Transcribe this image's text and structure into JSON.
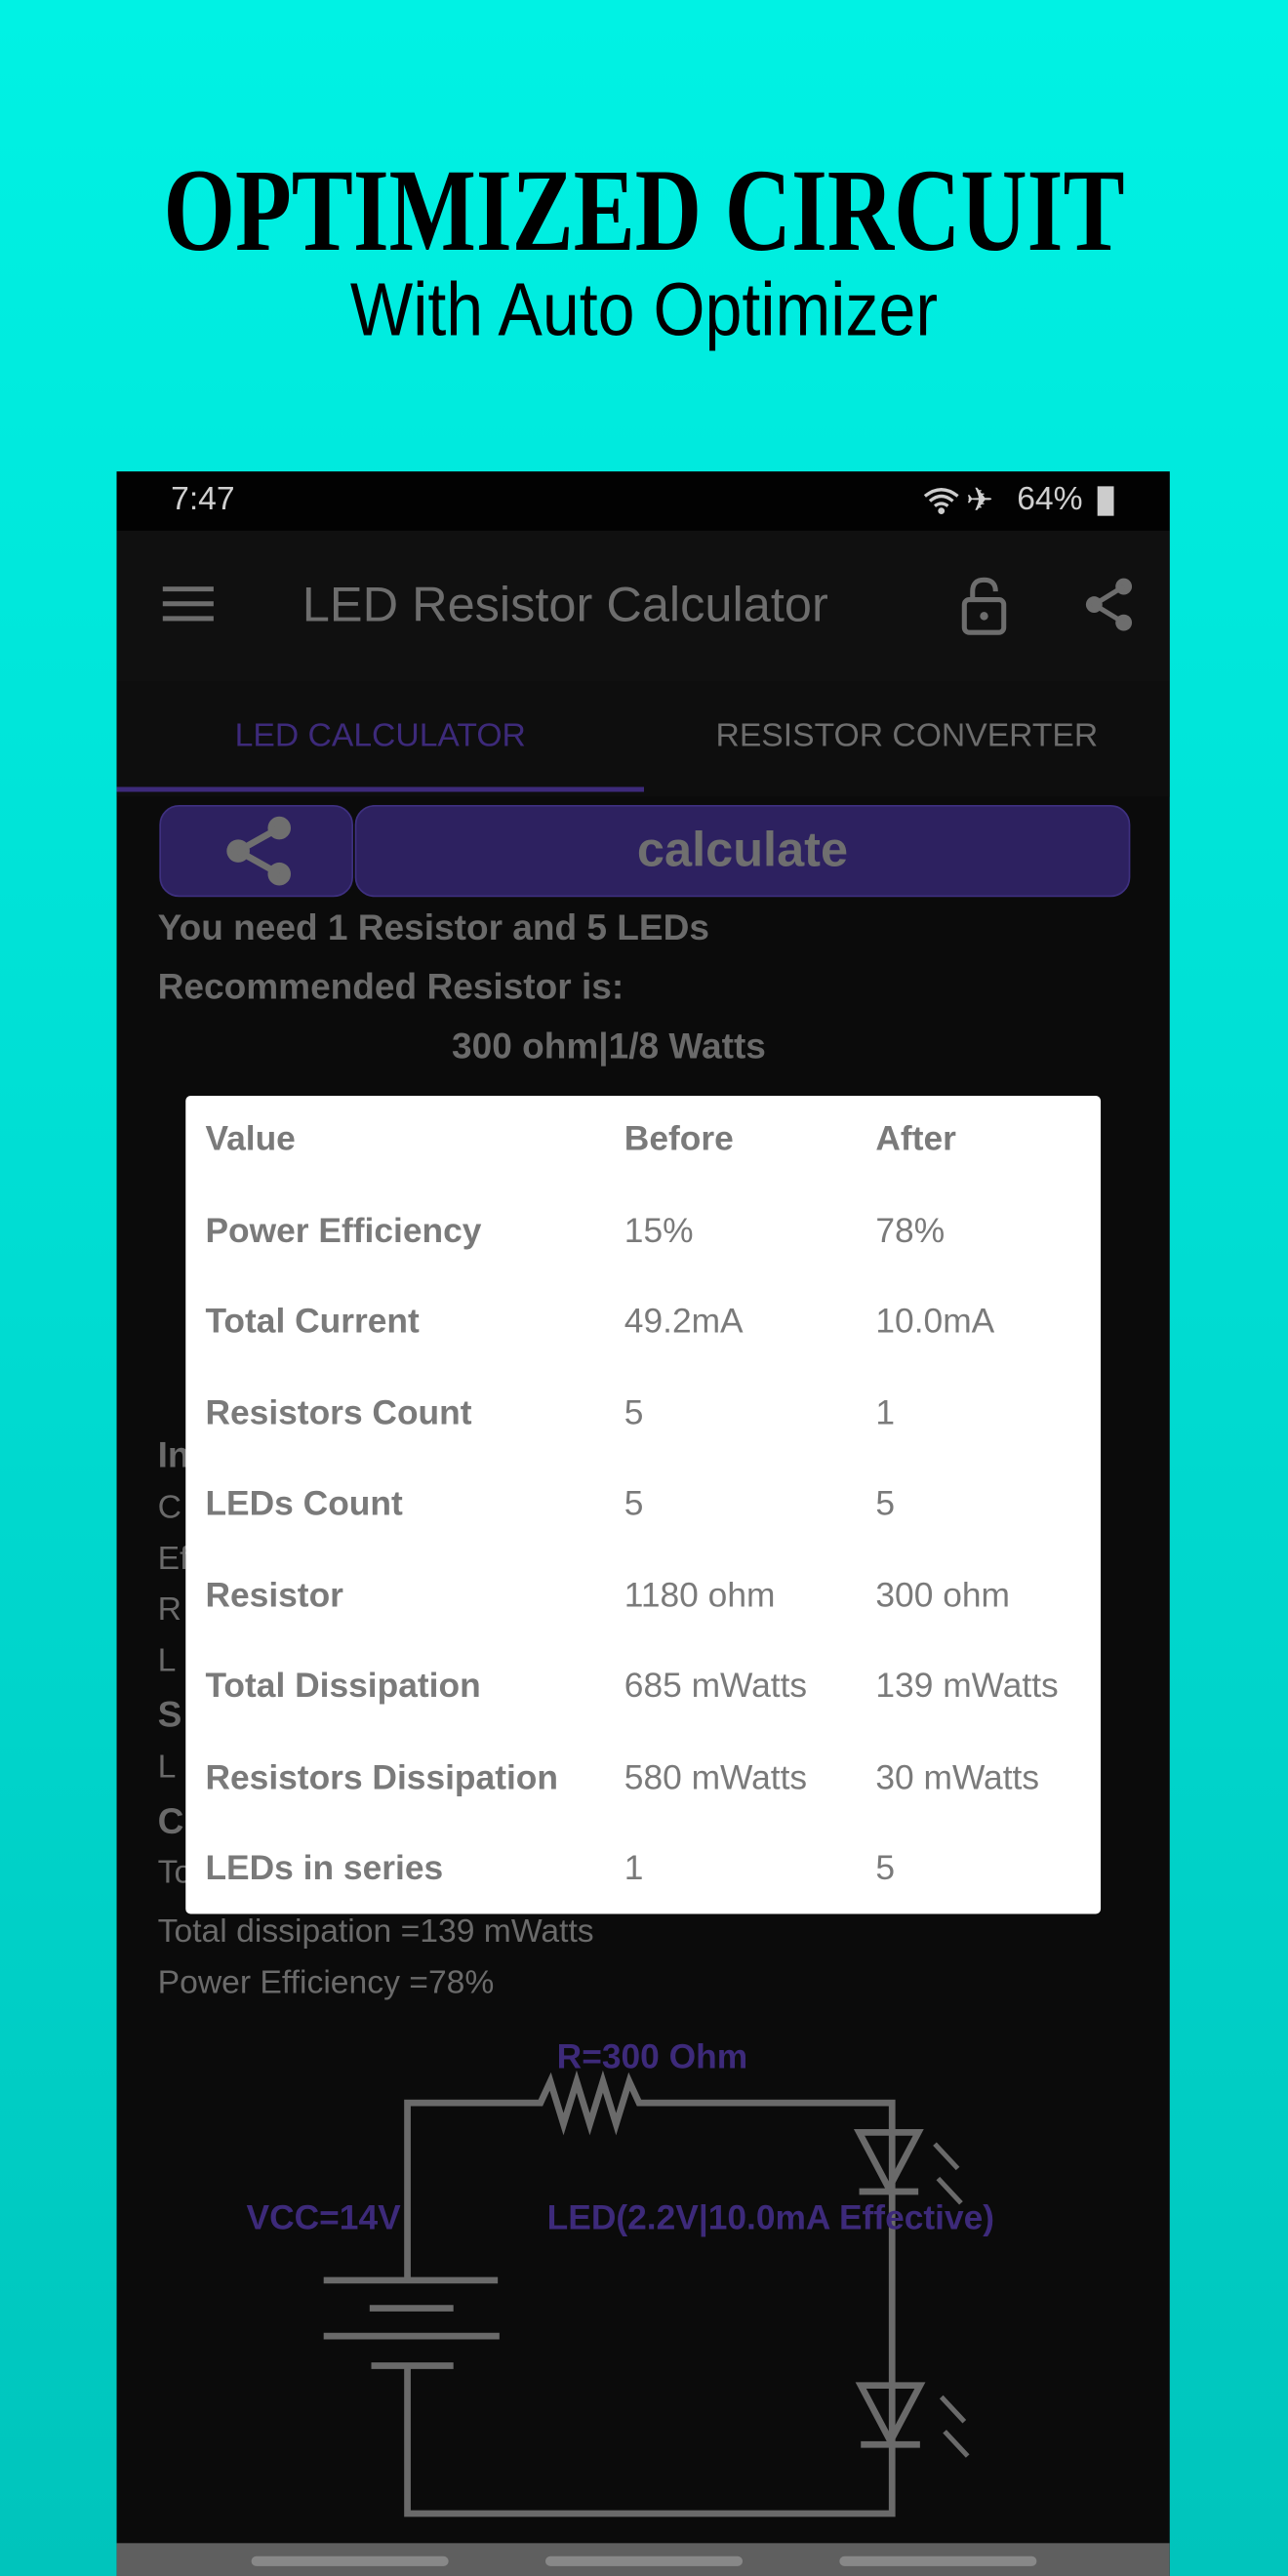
{
  "promo": {
    "title": "OPTIMIZED CIRCUIT",
    "subtitle": "With Auto Optimizer"
  },
  "status_bar": {
    "time": "7:47",
    "battery": "64%",
    "icons": [
      "wifi-icon",
      "airplane-icon",
      "battery-icon"
    ]
  },
  "app_bar": {
    "title": "LED Resistor Calculator",
    "icons": [
      "menu-icon",
      "lock-open-icon",
      "share-icon"
    ]
  },
  "tabs": [
    {
      "label": "LED CALCULATOR",
      "active": true
    },
    {
      "label": "RESISTOR CONVERTER",
      "active": false
    }
  ],
  "actions": {
    "calculate_label": "calculate"
  },
  "result": {
    "line1": "You need 1 Resistor and 5 LEDs",
    "line2": "Recommended Resistor is:",
    "line3": "300 ohm|1/8 Watts"
  },
  "hidden_fragments": [
    "In",
    "C",
    "Ef",
    "R",
    "L",
    "S",
    "L",
    "C",
    "To"
  ],
  "summary": {
    "total_dissipation": "Total dissipation =139 mWatts",
    "power_efficiency": "Power Efficiency =78%"
  },
  "dialog": {
    "headers": [
      "Value",
      "Before",
      "After"
    ],
    "rows": [
      [
        "Power Efficiency",
        "15%",
        "78%"
      ],
      [
        "Total Current",
        "49.2mA",
        "10.0mA"
      ],
      [
        "Resistors Count",
        "5",
        "1"
      ],
      [
        "LEDs Count",
        "5",
        "5"
      ],
      [
        "Resistor",
        "1180 ohm",
        "300 ohm"
      ],
      [
        "Total Dissipation",
        "685 mWatts",
        "139 mWatts"
      ],
      [
        "Resistors Dissipation",
        "580 mWatts",
        "30 mWatts"
      ],
      [
        "LEDs in series",
        "1",
        "5"
      ]
    ]
  },
  "circuit": {
    "resistor_label": "R=300  Ohm",
    "vcc_label": "VCC=14V",
    "led_label": "LED(2.2V|10.0mA Effective)"
  },
  "colors": {
    "accent": "#3d2a7a",
    "background_top": "#00f2e4",
    "background_bottom": "#00c4bc"
  }
}
